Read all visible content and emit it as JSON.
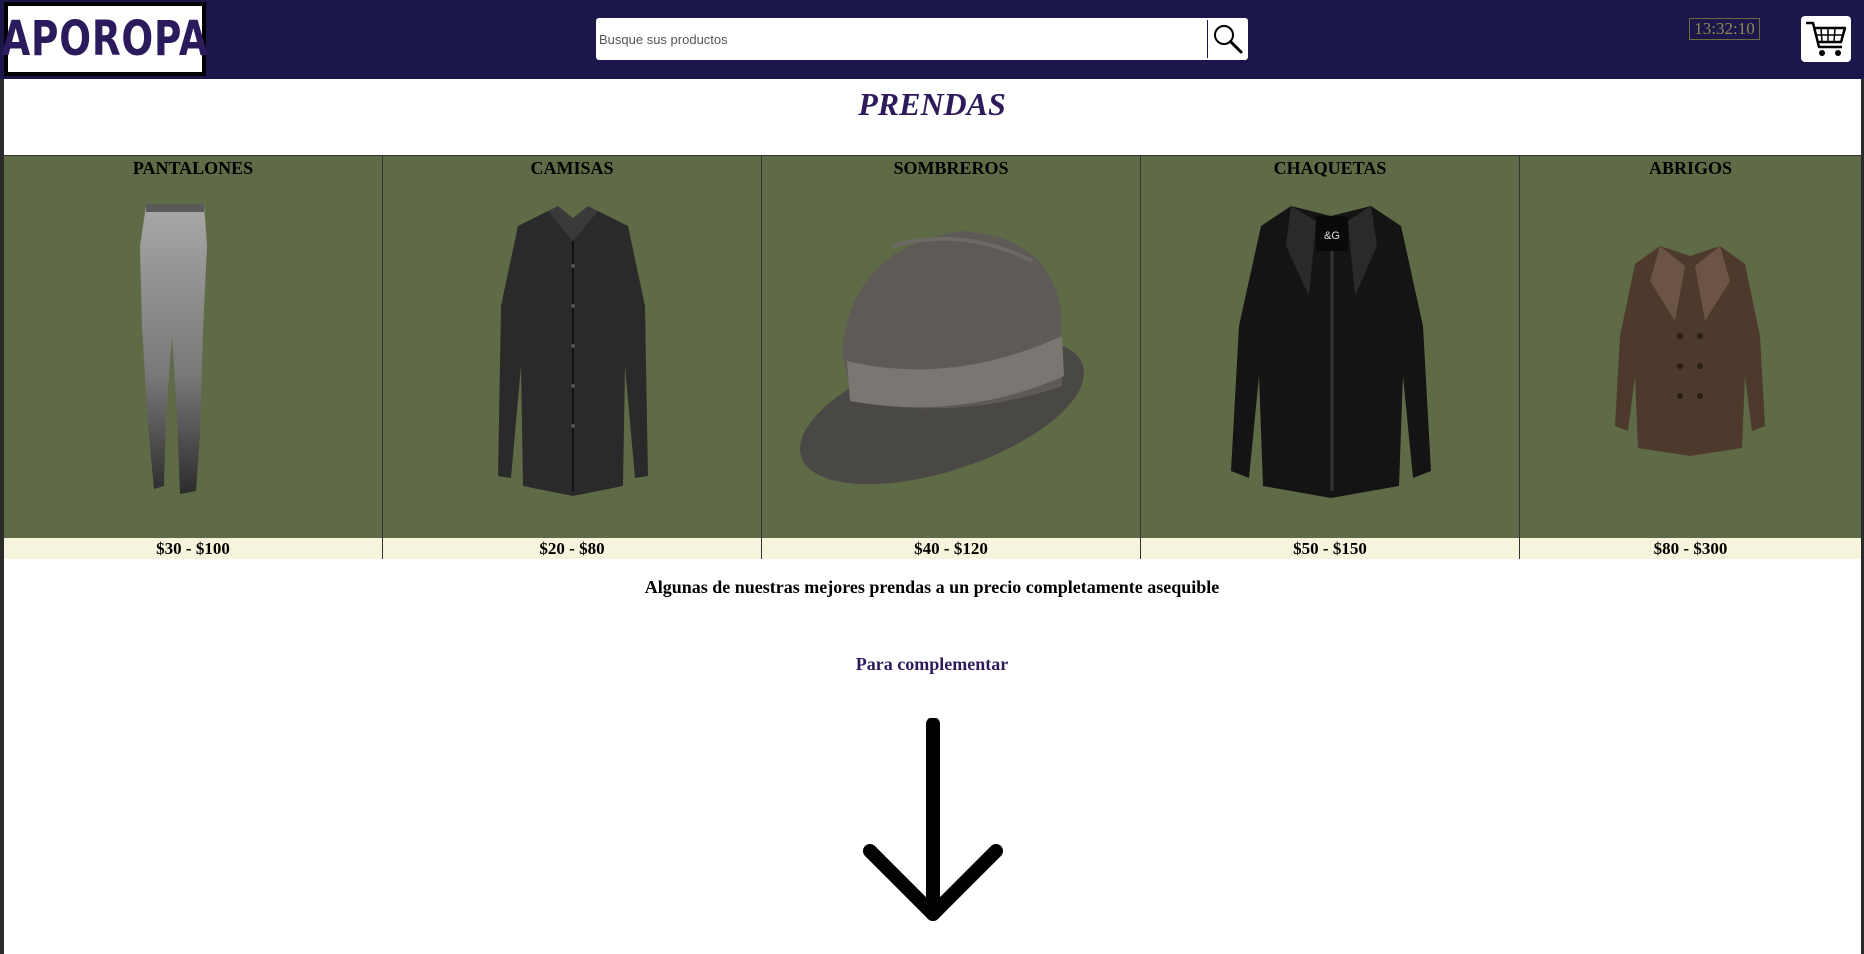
{
  "header": {
    "logo_text": "APOROPA",
    "search": {
      "placeholder": "Busque sus productos",
      "value": "",
      "button_icon": "search-icon"
    },
    "clock": "13:32:10",
    "cart_icon": "cart-icon",
    "background": "#1c174a"
  },
  "page": {
    "title": "PRENDAS"
  },
  "categories": [
    {
      "name": "PANTALONES",
      "price": "$30 - $100",
      "image": "pants-image"
    },
    {
      "name": "CAMISAS",
      "price": "$20 - $80",
      "image": "shirt-image"
    },
    {
      "name": "SOMBREROS",
      "price": "$40 - $120",
      "image": "hat-image"
    },
    {
      "name": "CHAQUETAS",
      "price": "$50 - $150",
      "image": "jacket-image"
    },
    {
      "name": "ABRIGOS",
      "price": "$80 - $300",
      "image": "coat-image"
    }
  ],
  "tagline": "Algunas de nuestras mejores prendas a un precio completamente asequible",
  "complement_heading": "Para complementar",
  "arrow_icon": "arrow-down-icon",
  "colors": {
    "accent": "#2f1b5c",
    "card_bg": "#5f6b46",
    "price_bg": "#f6f4dc"
  }
}
